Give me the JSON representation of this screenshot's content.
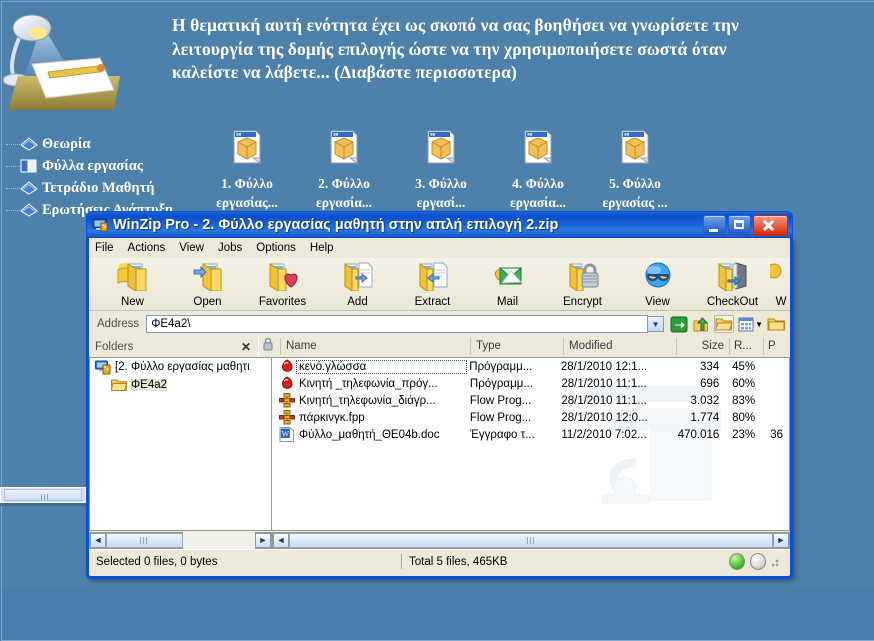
{
  "slide": {
    "headline": "Η θεματική αυτή ενότητα έχει ως σκοπό να σας βοηθήσει  να γνωρίσετε την λειτουργία της δομής επιλογής ώστε να την χρησιμοποιήσετε  σωστά όταν καλείστε να λάβετε... (Διαβάστε περισσοτερα)",
    "lamp_icon": "desk-lamp-illustration",
    "tree_items": [
      {
        "label": "Θεωρία",
        "icon": "book-icon"
      },
      {
        "label": "Φύλλα εργασίας",
        "icon": "open-book-icon"
      },
      {
        "label": "Τετράδιο Μαθητή",
        "icon": "book-icon"
      },
      {
        "label": "Ερωτήσεις Ανάπτυξη",
        "icon": "book-icon"
      }
    ],
    "zip_items": [
      {
        "line1": "1. Φύλλο",
        "line2": "εργασίας...",
        "icon": "zip-file-icon"
      },
      {
        "line1": "2. Φύλλο",
        "line2": "εργασία...",
        "icon": "zip-file-icon"
      },
      {
        "line1": "3. Φύλλο",
        "line2": "εργασί...",
        "icon": "zip-file-icon"
      },
      {
        "line1": "4. Φύλλο",
        "line2": "εργασία...",
        "icon": "zip-file-icon"
      },
      {
        "line1": "5. Φύλλο",
        "line2": "εργασίας ...",
        "icon": "zip-file-icon"
      }
    ],
    "bg_color": "#4d80ab"
  },
  "window": {
    "title": "WinZip Pro - 2. Φύλλο εργασίας μαθητή στην απλή επιλογή 2.zip",
    "icon": "winzip-app-icon",
    "titlebar_color": "#0b51d6",
    "buttons": {
      "minimize": "minimize-button",
      "maximize": "maximize-button",
      "close": "close-button"
    },
    "menu": [
      "File",
      "Actions",
      "View",
      "Jobs",
      "Options",
      "Help"
    ],
    "toolbar": [
      {
        "label": "New",
        "icon": "new-archive-icon"
      },
      {
        "label": "Open",
        "icon": "open-archive-icon"
      },
      {
        "label": "Favorites",
        "icon": "favorites-heart-icon"
      },
      {
        "label": "Add",
        "icon": "add-files-icon"
      },
      {
        "label": "Extract",
        "icon": "extract-files-icon"
      },
      {
        "label": "Mail",
        "icon": "mail-envelope-icon"
      },
      {
        "label": "Encrypt",
        "icon": "encrypt-padlock-icon"
      },
      {
        "label": "View",
        "icon": "view-sunglasses-icon"
      },
      {
        "label": "CheckOut",
        "icon": "checkout-icon"
      },
      {
        "label": "W",
        "icon": "wizard-icon"
      }
    ],
    "address": {
      "label": "Address",
      "value": "ΦΕ4a2\\",
      "dropdown_icon": "chevron-down-icon",
      "icons": [
        "go-arrow-icon",
        "up-folder-icon",
        "open-folder-icon",
        "views-grid-icon",
        "folders-toggle-icon"
      ]
    },
    "folders_pane": {
      "header": "Folders",
      "close_label": "✕",
      "nodes": [
        {
          "label": "[2. Φύλλο εργασίας μαθητι",
          "icon": "archive-root-icon",
          "selected": false
        },
        {
          "label": "ΦΕ4a2",
          "icon": "folder-icon",
          "selected": true
        }
      ]
    },
    "list": {
      "columns": [
        "Name",
        "Type",
        "Modified",
        "Size",
        "R...",
        "P"
      ],
      "lock_column_icon": "padlock-column-icon",
      "rows": [
        {
          "name": "κενό.γλώσσα",
          "type": "Πρόγραμμ...",
          "modified": "28/1/2010 12:1...",
          "size": "334",
          "ratio": "45%",
          "packed": "",
          "icon": "glossa-program-icon",
          "focused": true
        },
        {
          "name": "Κινητή _τηλεφωνία_πρόγ...",
          "type": "Πρόγραμμ...",
          "modified": "28/1/2010 11:1...",
          "size": "696",
          "ratio": "60%",
          "packed": "",
          "icon": "glossa-program-icon",
          "focused": false
        },
        {
          "name": "Κινητή_τηλεφωνία_διάγρ...",
          "type": "Flow Prog...",
          "modified": "28/1/2010 11:1...",
          "size": "3.032",
          "ratio": "83%",
          "packed": "",
          "icon": "flowchart-icon",
          "focused": false
        },
        {
          "name": "πάρκινγκ.fpp",
          "type": "Flow Prog...",
          "modified": "28/1/2010 12:0...",
          "size": "1.774",
          "ratio": "80%",
          "packed": "",
          "icon": "flowchart-icon",
          "focused": false
        },
        {
          "name": "Φύλλο_μαθητή_ΘΕ04b.doc",
          "type": "Έγγραφο τ...",
          "modified": "11/2/2010 7:02...",
          "size": "470.016",
          "ratio": "23%",
          "packed": "36",
          "icon": "word-document-icon",
          "focused": false
        }
      ]
    },
    "status": {
      "selected": "Selected 0 files, 0 bytes",
      "total": "Total 5 files, 465KB",
      "led_green": "#3fc12a",
      "led_grey": "#d6d6cc"
    }
  }
}
